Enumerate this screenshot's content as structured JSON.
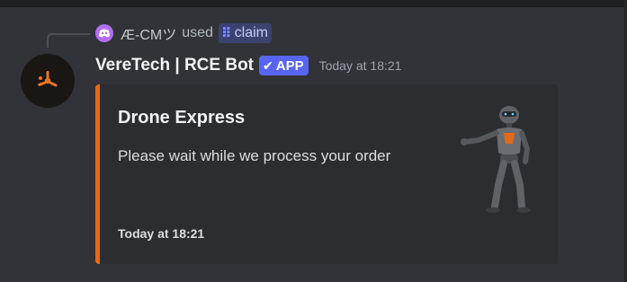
{
  "reply": {
    "user": "Æ-CMツ",
    "used_text": "used",
    "command_icon": "slash-command-icon",
    "command": "claim"
  },
  "message": {
    "author": "VereTech | RCE Bot",
    "badge": "APP",
    "timestamp": "Today at 18:21",
    "avatar_icon": "drone-logo-icon"
  },
  "embed": {
    "accent_color": "#e06a1a",
    "title": "Drone Express",
    "description": "Please wait while we process your order",
    "thumbnail_icon": "robot-thumbnail",
    "footer": "Today at 18:21"
  },
  "colors": {
    "background": "#313338",
    "embed_background": "#2b2d31",
    "app_badge": "#5865f2",
    "command_chip": "#3c4270"
  }
}
